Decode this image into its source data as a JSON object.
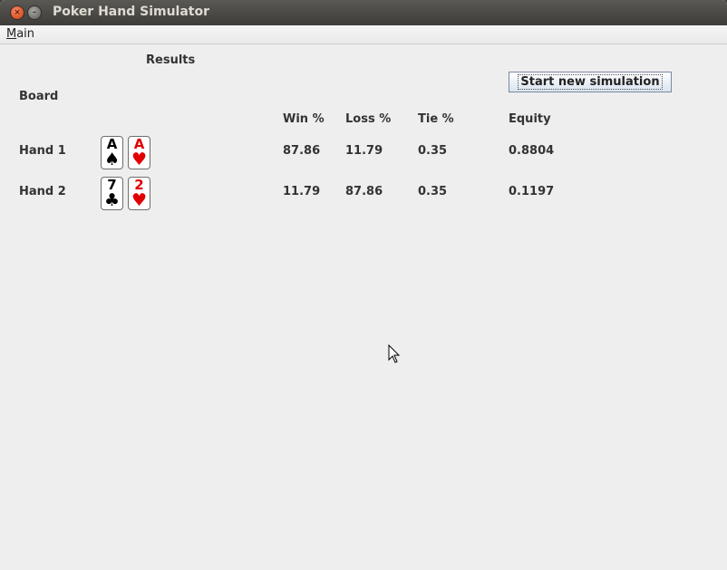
{
  "window": {
    "title": "Poker Hand Simulator"
  },
  "menu": {
    "main_mnemonic": "M",
    "main_rest": "ain"
  },
  "labels": {
    "results": "Results",
    "board": "Board"
  },
  "button": {
    "start_label": "Start new simulation"
  },
  "columns": {
    "win": "Win %",
    "loss": "Loss %",
    "tie": "Tie %",
    "equity": "Equity"
  },
  "hands": [
    {
      "label": "Hand 1",
      "cards": [
        {
          "rank": "A",
          "suit": "♠",
          "color": "#000000"
        },
        {
          "rank": "A",
          "suit": "♥",
          "color": "#e00000"
        }
      ],
      "win": "87.86",
      "loss": "11.79",
      "tie": "0.35",
      "equity": "0.8804"
    },
    {
      "label": "Hand 2",
      "cards": [
        {
          "rank": "7",
          "suit": "♣",
          "color": "#000000"
        },
        {
          "rank": "2",
          "suit": "♥",
          "color": "#e00000"
        }
      ],
      "win": "11.79",
      "loss": "87.86",
      "tie": "0.35",
      "equity": "0.1197"
    }
  ]
}
